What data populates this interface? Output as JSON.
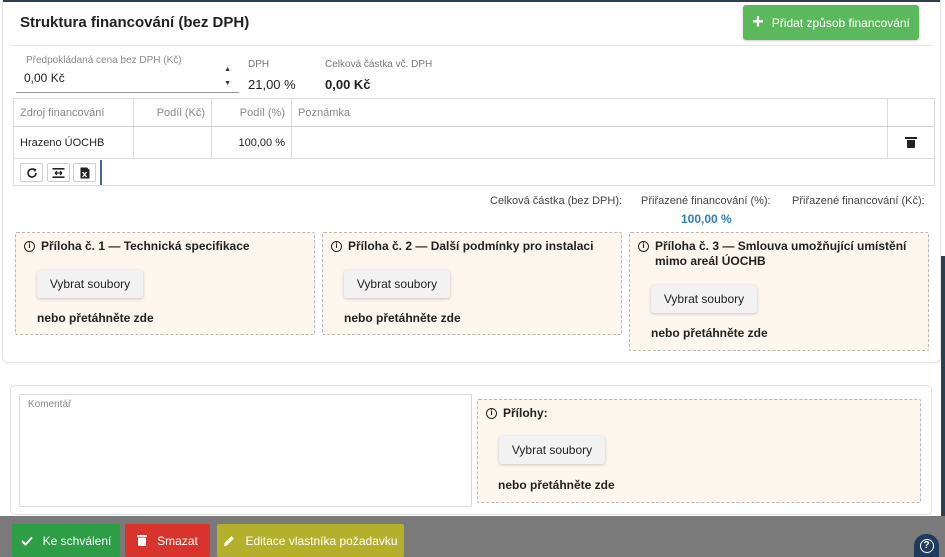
{
  "header": {
    "title": "Struktura financování (bez DPH)",
    "add_button": "Přidat způsob financování"
  },
  "price": {
    "label": "Předpokládaná cena bez DPH (Kč)",
    "value": "0,00 Kč"
  },
  "dph": {
    "label": "DPH",
    "value": "21,00 %"
  },
  "total": {
    "label": "Celková částka vč. DPH",
    "value": "0,00 Kč"
  },
  "grid": {
    "columns": [
      "Zdroj financování",
      "Podíl (Kč)",
      "Podíl (%)",
      "Poznámka"
    ],
    "rows": [
      {
        "source": "Hrazeno ÚOCHB",
        "share_czk": "",
        "share_pct": "100,00 %",
        "note": ""
      }
    ]
  },
  "summary": {
    "total_label": "Celková částka (bez DPH):",
    "assigned_pct_label": "Přiřazené financování (%):",
    "assigned_czk_label": "Přiřazené financování (Kč):",
    "assigned_pct_value": "100,00 %"
  },
  "attachments": [
    {
      "title": "Příloha č. 1 — Technická specifikace",
      "button": "Vybrat soubory",
      "drop": "nebo přetáhněte zde"
    },
    {
      "title": "Příloha č. 2 — Další podmínky pro instalaci",
      "button": "Vybrat soubory",
      "drop": "nebo přetáhněte zde"
    },
    {
      "title": "Příloha č. 3 — Smlouva umožňující umístění mimo areál ÚOCHB",
      "button": "Vybrat soubory",
      "drop": "nebo přetáhněte zde"
    }
  ],
  "comment": {
    "label": "Komentář",
    "value": ""
  },
  "extra_attachments": {
    "title": "Přílohy:",
    "button": "Vybrat soubory",
    "drop": "nebo přetáhněte zde"
  },
  "actions": {
    "approve": "Ke schválení",
    "delete": "Smazat",
    "edit_owner": "Editace vlastníka požadavku"
  },
  "colors": {
    "add_button": "#5cb85c",
    "approve": "#2e9e46",
    "delete": "#d9342b",
    "edit": "#b5b02c",
    "percent_value": "#2f7fc1",
    "attachment_bg": "#fdf6ee"
  },
  "icons": [
    "plus-icon",
    "refresh-icon",
    "fit-columns-icon",
    "excel-export-icon",
    "trash-icon",
    "info-icon",
    "check-icon",
    "pencil-icon",
    "help-icon"
  ]
}
